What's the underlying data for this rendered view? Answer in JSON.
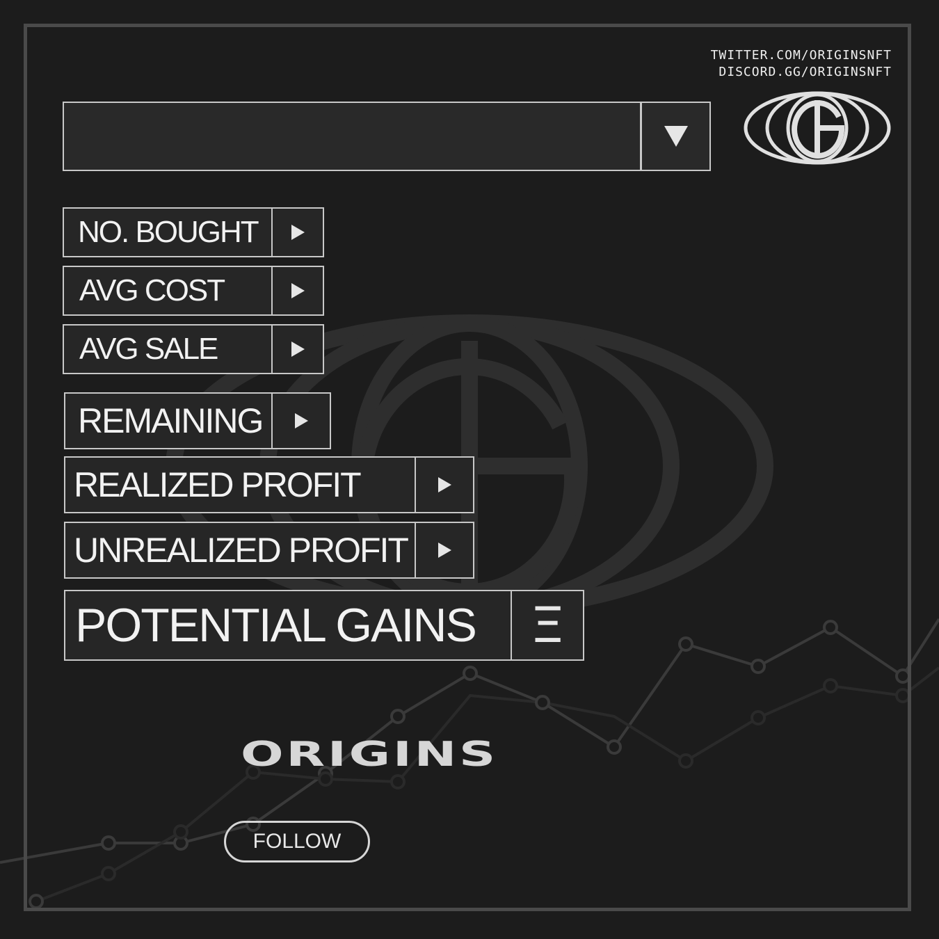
{
  "links": {
    "twitter": "TWITTER.COM/ORIGINSNFT",
    "discord": "DISCORD.GG/ORIGINSNFT"
  },
  "dropdown": {
    "value": "",
    "icon": "triangle-down-icon"
  },
  "stats": [
    {
      "label": "NO. BOUGHT",
      "icon": "play-icon"
    },
    {
      "label": "AVG COST",
      "icon": "play-icon"
    },
    {
      "label": "AVG SALE",
      "icon": "play-icon"
    },
    {
      "label": "REMAINING",
      "icon": "play-icon"
    },
    {
      "label": "REALIZED PROFIT",
      "icon": "play-icon"
    },
    {
      "label": "UNREALIZED PROFIT",
      "icon": "play-icon"
    },
    {
      "label": "POTENTIAL GAINS",
      "icon": "ethereum-icon",
      "symbol": "Ξ"
    }
  ],
  "brand": {
    "name": "ORIGINS"
  },
  "follow": {
    "label": "FOLLOW"
  },
  "colors": {
    "background": "#1c1c1c",
    "frame": "#4a4a4a",
    "accent": "#e6e6e6"
  }
}
